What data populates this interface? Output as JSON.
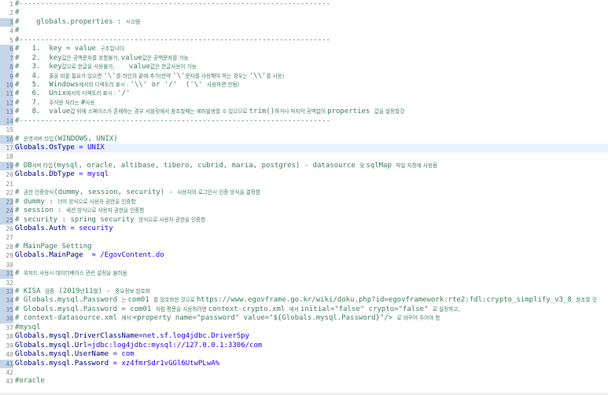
{
  "editor": {
    "current_line": 17,
    "lines": [
      {
        "num": "1",
        "mark": false,
        "segs": [
          {
            "t": "#-------------------------------------------------------------------------",
            "c": "c"
          }
        ]
      },
      {
        "num": "2",
        "mark": false,
        "segs": [
          {
            "t": "#",
            "c": "c"
          }
        ]
      },
      {
        "num": "3",
        "mark": true,
        "segs": [
          {
            "t": "#    globals.properties : ",
            "c": "c"
          },
          {
            "t": "시스템",
            "c": "c ko"
          }
        ]
      },
      {
        "num": "4",
        "mark": false,
        "segs": [
          {
            "t": "#",
            "c": "c"
          }
        ]
      },
      {
        "num": "5",
        "mark": false,
        "segs": [
          {
            "t": "#-------------------------------------------------------------------------",
            "c": "c"
          }
        ]
      },
      {
        "num": "6",
        "mark": true,
        "segs": [
          {
            "t": "#   1.  key = value ",
            "c": "c"
          },
          {
            "t": "구조입니다.",
            "c": "c ko"
          }
        ]
      },
      {
        "num": "7",
        "mark": true,
        "segs": [
          {
            "t": "#   2.  key",
            "c": "c"
          },
          {
            "t": "값은 공백문자를 포함불가, ",
            "c": "c ko"
          },
          {
            "t": "value",
            "c": "c"
          },
          {
            "t": "값은 공백문자를 가능",
            "c": "c ko"
          }
        ]
      },
      {
        "num": "8",
        "mark": true,
        "segs": [
          {
            "t": "#   3.  key",
            "c": "c"
          },
          {
            "t": "값으로 한글을 사용불가, ",
            "c": "c ko"
          },
          {
            "t": "   value",
            "c": "c"
          },
          {
            "t": "값은 한글사용이 가능",
            "c": "c ko"
          }
        ]
      },
      {
        "num": "9",
        "mark": true,
        "segs": [
          {
            "t": "#   4.  ",
            "c": "c"
          },
          {
            "t": "줄을 바꿀 필요가 있으면 ",
            "c": "c ko"
          },
          {
            "t": "'\\'",
            "c": "c"
          },
          {
            "t": "를 라인의 끝에 추가(만약 ",
            "c": "c ko"
          },
          {
            "t": "'\\'",
            "c": "c"
          },
          {
            "t": "문자를 사용해야 하는 경우는 ",
            "c": "c ko"
          },
          {
            "t": "'\\\\'",
            "c": "c"
          },
          {
            "t": "를 사용)",
            "c": "c ko"
          }
        ]
      },
      {
        "num": "10",
        "mark": true,
        "segs": [
          {
            "t": "#   5.  Windows",
            "c": "c"
          },
          {
            "t": "에서의 디렉토리 표시 : ",
            "c": "c ko"
          },
          {
            "t": "'\\\\' or '/'  ('\\' ",
            "c": "c"
          },
          {
            "t": "사용하면 안됨)",
            "c": "c ko"
          }
        ]
      },
      {
        "num": "11",
        "mark": true,
        "segs": [
          {
            "t": "#   6.  Unix",
            "c": "c"
          },
          {
            "t": "에서의 디렉토리 표시 : ",
            "c": "c ko"
          },
          {
            "t": "'/'",
            "c": "c"
          }
        ]
      },
      {
        "num": "12",
        "mark": true,
        "segs": [
          {
            "t": "#   7.  ",
            "c": "c"
          },
          {
            "t": "주석문 처리는 ",
            "c": "c ko"
          },
          {
            "t": "#",
            "c": "c"
          },
          {
            "t": "사용",
            "c": "c ko"
          }
        ]
      },
      {
        "num": "13",
        "mark": true,
        "segs": [
          {
            "t": "#   8.  value",
            "c": "c"
          },
          {
            "t": "값 뒤에 스페이스가 존재하는 경우 서블릿에서 참조할때는 에러발생할 수 있으므로 ",
            "c": "c ko"
          },
          {
            "t": "trim()",
            "c": "c"
          },
          {
            "t": "하거나 마지막 공백없이 ",
            "c": "c ko"
          },
          {
            "t": "properties ",
            "c": "c"
          },
          {
            "t": "값을 설정할것",
            "c": "c ko"
          }
        ]
      },
      {
        "num": "14",
        "mark": true,
        "segs": [
          {
            "t": "#-------------------------------------------------------------------------",
            "c": "c"
          }
        ]
      },
      {
        "num": "15",
        "mark": false,
        "segs": []
      },
      {
        "num": "16",
        "mark": true,
        "segs": [
          {
            "t": "# ",
            "c": "c"
          },
          {
            "t": "운영서버 타입",
            "c": "c ko"
          },
          {
            "t": "(WINDOWS, UNIX)",
            "c": "c"
          }
        ]
      },
      {
        "num": "17",
        "mark": false,
        "segs": [
          {
            "t": "Globals.OsType",
            "c": "k"
          },
          {
            "t": " = UNIX",
            "c": "k2"
          }
        ]
      },
      {
        "num": "18",
        "mark": false,
        "segs": []
      },
      {
        "num": "19",
        "mark": true,
        "segs": [
          {
            "t": "# DB",
            "c": "c"
          },
          {
            "t": "서버 타입",
            "c": "c ko"
          },
          {
            "t": "(mysql, oracle, altibase, tibero, cubrid, maria, postgres) - datasource ",
            "c": "c"
          },
          {
            "t": "및 ",
            "c": "c ko"
          },
          {
            "t": "sqlMap ",
            "c": "c"
          },
          {
            "t": "파일 지정에 사용됨",
            "c": "c ko"
          }
        ]
      },
      {
        "num": "20",
        "mark": false,
        "segs": [
          {
            "t": "Globals.DbType",
            "c": "k"
          },
          {
            "t": " = mysql",
            "c": "k2"
          }
        ]
      },
      {
        "num": "21",
        "mark": false,
        "segs": []
      },
      {
        "num": "22",
        "mark": false,
        "segs": [
          {
            "t": "# ",
            "c": "c"
          },
          {
            "t": "권한 인증방식",
            "c": "c ko"
          },
          {
            "t": "(dummy, session, security) - ",
            "c": "c"
          },
          {
            "t": "사용자의 로그인시 인증 방식을 결정함",
            "c": "c ko"
          }
        ]
      },
      {
        "num": "23",
        "mark": true,
        "segs": [
          {
            "t": "# dummy : ",
            "c": "c"
          },
          {
            "t": "더미 방식으로 사용자 권한을 인증함",
            "c": "c ko"
          }
        ]
      },
      {
        "num": "24",
        "mark": true,
        "segs": [
          {
            "t": "# session : ",
            "c": "c"
          },
          {
            "t": "세션 방식으로 사용자 권한을 인증함",
            "c": "c ko"
          }
        ]
      },
      {
        "num": "25",
        "mark": true,
        "segs": [
          {
            "t": "# security : spring security ",
            "c": "c"
          },
          {
            "t": "방식으로 사용자 권한을 인증함",
            "c": "c ko"
          }
        ]
      },
      {
        "num": "26",
        "mark": false,
        "segs": [
          {
            "t": "Globals.Auth",
            "c": "k"
          },
          {
            "t": " = security",
            "c": "k2"
          }
        ]
      },
      {
        "num": "27",
        "mark": false,
        "segs": []
      },
      {
        "num": "28",
        "mark": false,
        "segs": [
          {
            "t": "# MainPage Setting",
            "c": "c"
          }
        ]
      },
      {
        "num": "29",
        "mark": false,
        "segs": [
          {
            "t": "Globals.MainPage",
            "c": "k"
          },
          {
            "t": "  = /EgovContent.do",
            "c": "k2"
          }
        ]
      },
      {
        "num": "30",
        "mark": false,
        "segs": []
      },
      {
        "num": "31",
        "mark": true,
        "segs": [
          {
            "t": "# ",
            "c": "c"
          },
          {
            "t": "위저드 사용시 데이터베이스 관련 설정을 불러옴",
            "c": "c ko"
          }
        ]
      },
      {
        "num": "32",
        "mark": false,
        "segs": []
      },
      {
        "num": "33",
        "mark": true,
        "segs": [
          {
            "t": "# KISA ",
            "c": "c"
          },
          {
            "t": "검증",
            "c": "c ko"
          },
          {
            "t": " (2019",
            "c": "c"
          },
          {
            "t": "년",
            "c": "c ko"
          },
          {
            "t": "11",
            "c": "c"
          },
          {
            "t": "월",
            "c": "c ko"
          },
          {
            "t": ") - ",
            "c": "c"
          },
          {
            "t": "중요정보 암호화",
            "c": "c ko"
          }
        ]
      },
      {
        "num": "34",
        "mark": true,
        "segs": [
          {
            "t": "# Globals.mysql.Password ",
            "c": "c"
          },
          {
            "t": "는 ",
            "c": "c ko"
          },
          {
            "t": "com01 ",
            "c": "c"
          },
          {
            "t": "를 암호화한 것으로 ",
            "c": "c ko"
          },
          {
            "t": "https://www.egovframe.go.kr/wiki/doku.php?id=egovframework:rte2:fdl:crypto_simplify_v3_8 ",
            "c": "c"
          },
          {
            "t": "참조할 것",
            "c": "c ko"
          }
        ]
      },
      {
        "num": "35",
        "mark": true,
        "segs": [
          {
            "t": "# Globals.mysql.Password = com01 ",
            "c": "c"
          },
          {
            "t": "처럼 평문을 사용하려면 ",
            "c": "c ko"
          },
          {
            "t": "context-crypto.xml ",
            "c": "c"
          },
          {
            "t": "에서 ",
            "c": "c ko"
          },
          {
            "t": "initial=\"false\" crypto=\"false\" ",
            "c": "c"
          },
          {
            "t": "로 설정하고,",
            "c": "c ko"
          }
        ]
      },
      {
        "num": "36",
        "mark": true,
        "segs": [
          {
            "t": "# context-datasource.xml ",
            "c": "c"
          },
          {
            "t": "에서 ",
            "c": "c ko"
          },
          {
            "t": "<property name=\"password\" value=\"${Globals.mysql.Password}\"/> ",
            "c": "c"
          },
          {
            "t": "로 바꾸어 주어야 함",
            "c": "c ko"
          }
        ]
      },
      {
        "num": "37",
        "mark": false,
        "segs": [
          {
            "t": "#mysql",
            "c": "c"
          }
        ]
      },
      {
        "num": "38",
        "mark": false,
        "segs": [
          {
            "t": "Globals.mysql.DriverClassName",
            "c": "k"
          },
          {
            "t": "=net.sf.log4jdbc.DriverSpy",
            "c": "k2"
          }
        ]
      },
      {
        "num": "39",
        "mark": false,
        "segs": [
          {
            "t": "Globals.mysql.Url",
            "c": "k"
          },
          {
            "t": "=jdbc:log4jdbc:mysql://127.0.0.1:3306/com",
            "c": "k2"
          }
        ]
      },
      {
        "num": "40",
        "mark": false,
        "segs": [
          {
            "t": "Globals.mysql.UserName",
            "c": "k"
          },
          {
            "t": " = com",
            "c": "k2"
          }
        ]
      },
      {
        "num": "41",
        "mark": true,
        "segs": [
          {
            "t": "Globals.mysql.Password",
            "c": "k"
          },
          {
            "t": " = xz4fmrSdr1vGGl6UtwPLwA%",
            "c": "k2"
          }
        ]
      },
      {
        "num": "42",
        "mark": false,
        "segs": []
      },
      {
        "num": "43",
        "mark": false,
        "segs": [
          {
            "t": "#oracle",
            "c": "c"
          }
        ]
      }
    ]
  }
}
